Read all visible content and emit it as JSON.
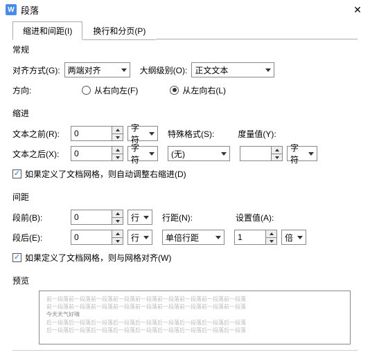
{
  "window": {
    "title": "段落",
    "icon_letter": "W"
  },
  "tabs": {
    "tab1": "缩进和间距(I)",
    "tab2": "换行和分页(P)"
  },
  "sections": {
    "general": "常规",
    "indent": "缩进",
    "spacing": "间距",
    "preview": "预览"
  },
  "general": {
    "align_label": "对齐方式(G):",
    "align_value": "两端对齐",
    "outline_label": "大纲级别(O):",
    "outline_value": "正文文本",
    "direction_label": "方向:",
    "rtl_label": "从右向左(F)",
    "ltr_label": "从左向右(L)"
  },
  "indent": {
    "before_label": "文本之前(R):",
    "before_value": "0",
    "before_unit": "字符",
    "after_label": "文本之后(X):",
    "after_value": "0",
    "after_unit": "字符",
    "special_label": "特殊格式(S):",
    "special_value": "(无)",
    "measure_label": "度量值(Y):",
    "measure_value": "",
    "measure_unit": "字符",
    "grid_check": "如果定义了文档网格，则自动调整右缩进(D)"
  },
  "spacing": {
    "before_label": "段前(B):",
    "before_value": "0",
    "before_unit": "行",
    "after_label": "段后(E):",
    "after_value": "0",
    "after_unit": "行",
    "line_label": "行距(N):",
    "line_value": "单倍行距",
    "setval_label": "设置值(A):",
    "setval_value": "1",
    "setval_unit": "倍",
    "grid_check": "如果定义了文档网格，则与网格对齐(W)"
  },
  "preview": {
    "context_line": "前一段落前一段落前一段落前一段落前一段落前一段落前一段落前一段落前一段落",
    "sample": "今天天气好晴",
    "after_line": "后一段落后一段落后一段落后一段落后一段落后一段落后一段落后一段落后一段落"
  }
}
